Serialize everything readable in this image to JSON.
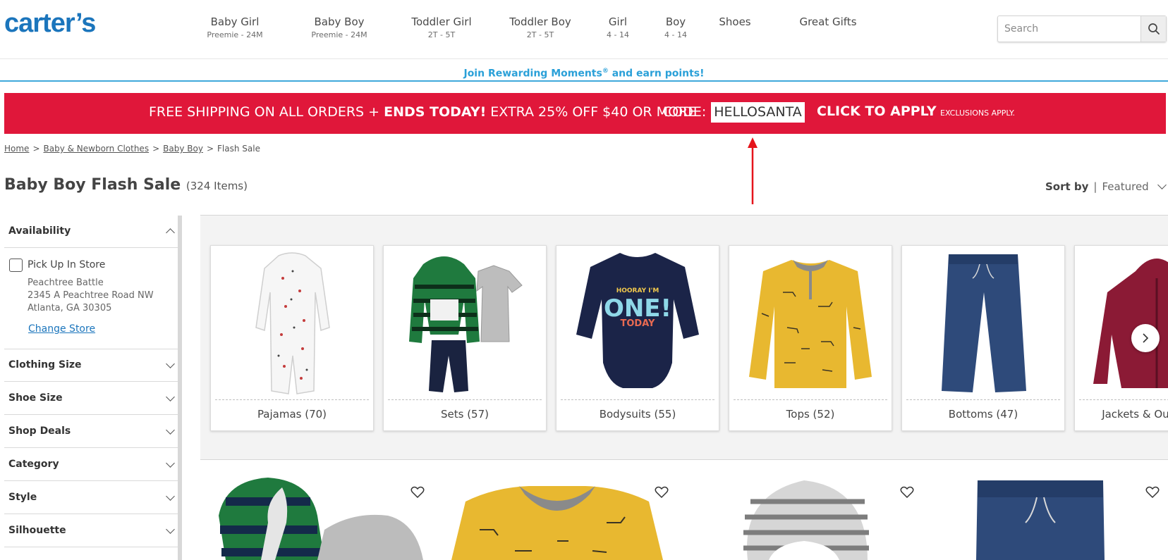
{
  "header": {
    "logo_text": "carter’s",
    "nav": [
      {
        "label": "Baby Girl",
        "sub": "Preemie - 24M"
      },
      {
        "label": "Baby Boy",
        "sub": "Preemie - 24M"
      },
      {
        "label": "Toddler Girl",
        "sub": "2T - 5T"
      },
      {
        "label": "Toddler Boy",
        "sub": "2T - 5T"
      },
      {
        "label": "Girl",
        "sub": "4 - 14"
      },
      {
        "label": "Boy",
        "sub": "4 - 14"
      },
      {
        "label": "Shoes",
        "sub": ""
      },
      {
        "label": "Great Gifts",
        "sub": ""
      }
    ],
    "search": {
      "placeholder": "Search",
      "value": ""
    }
  },
  "rewards": {
    "text_before": "Join Rewarding Moments",
    "registered": "®",
    "text_after": " and earn points!"
  },
  "promo": {
    "lead": "FREE SHIPPING ON ALL ORDERS + ",
    "bold": "ENDS TODAY!",
    "tail": " EXTRA 25% OFF $40 OR MORE",
    "code_label": "CODE:",
    "code": "HELLOSANTA",
    "apply": "CLICK TO APPLY",
    "exclusions": "EXCLUSIONS APPLY.",
    "color": "#e0173a"
  },
  "breadcrumb": {
    "items": [
      "Home",
      "Baby & Newborn Clothes",
      "Baby Boy"
    ],
    "current": "Flash Sale",
    "separator": ">"
  },
  "page": {
    "title": "Baby Boy Flash Sale",
    "count": "(324 Items)"
  },
  "sort": {
    "label": "Sort by",
    "separator": "|",
    "value": "Featured"
  },
  "sidebar": {
    "availability": {
      "label": "Availability",
      "pickup_label": "Pick Up In Store",
      "store_name": "Peachtree Battle",
      "store_address": "2345 A Peachtree Road NW",
      "store_city": "Atlanta, GA 30305",
      "change_store": "Change Store"
    },
    "filters": [
      "Clothing Size",
      "Shoe Size",
      "Shop Deals",
      "Category",
      "Style",
      "Silhouette"
    ]
  },
  "categories": [
    {
      "label": "Pajamas (70)"
    },
    {
      "label": "Sets (57)"
    },
    {
      "label": "Bodysuits (55)"
    },
    {
      "label": "Tops (52)"
    },
    {
      "label": "Bottoms (47)"
    },
    {
      "label": "Jackets & Outerwear"
    }
  ],
  "colors": {
    "brand": "#1b75bc",
    "rewards": "#2aa0d8",
    "promo": "#e0173a"
  },
  "icons": {
    "search": "magnifier-icon",
    "next": "chevron-right-icon",
    "heart": "heart-outline-icon"
  }
}
